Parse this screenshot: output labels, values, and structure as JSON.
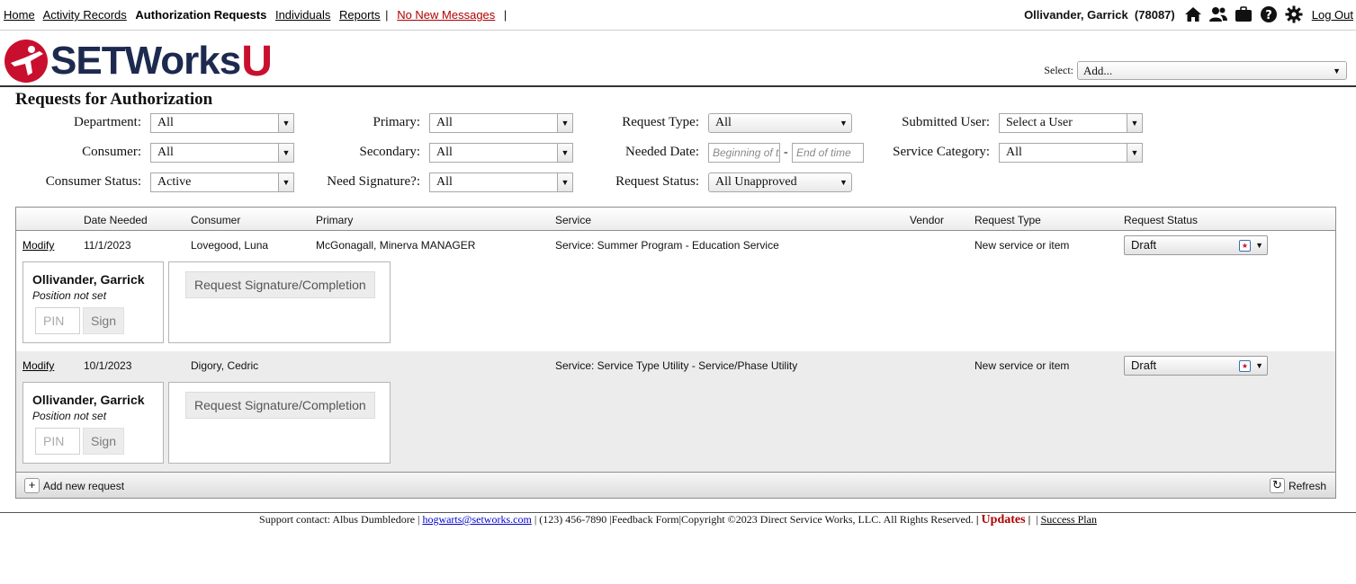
{
  "topnav": {
    "home": "Home",
    "activity_records": "Activity Records",
    "authorization_requests": "Authorization Requests",
    "individuals": "Individuals",
    "reports": "Reports",
    "sep1": "|",
    "messages": "No New Messages",
    "sep2": "|"
  },
  "user": {
    "name": "Ollivander, Garrick",
    "id": "(78087)",
    "logout": "Log Out",
    "icons": [
      "home-icon",
      "users-icon",
      "briefcase-icon",
      "help-icon",
      "gear-icon"
    ]
  },
  "logo": {
    "text": "SETWorks",
    "suffix": "U"
  },
  "select_add": {
    "label": "Select:",
    "value": "Add..."
  },
  "page": {
    "title": "Requests for Authorization"
  },
  "filters": {
    "department": {
      "label": "Department:",
      "value": "All"
    },
    "consumer": {
      "label": "Consumer:",
      "value": "All"
    },
    "consumer_status": {
      "label": "Consumer Status:",
      "value": "Active"
    },
    "primary": {
      "label": "Primary:",
      "value": "All"
    },
    "secondary": {
      "label": "Secondary:",
      "value": "All"
    },
    "need_signature": {
      "label": "Need Signature?:",
      "value": "All"
    },
    "request_type": {
      "label": "Request Type:",
      "value": "All"
    },
    "needed_date": {
      "label": "Needed Date:",
      "from_placeholder": "Beginning of time",
      "to_placeholder": "End of time",
      "dash": "-"
    },
    "request_status": {
      "label": "Request Status:",
      "value": "All Unapproved"
    },
    "submitted_user": {
      "label": "Submitted User:",
      "value": "Select a User"
    },
    "service_category": {
      "label": "Service Category:",
      "value": "All"
    }
  },
  "table": {
    "columns": [
      "Date Needed",
      "Consumer",
      "Primary",
      "Service",
      "Vendor",
      "Request Type",
      "Request Status"
    ],
    "rows": [
      {
        "action": "Modify",
        "date_needed": "11/1/2023",
        "consumer": "Lovegood, Luna",
        "primary": "McGonagall, Minerva MANAGER",
        "service": "Service: Summer Program - Education Service",
        "vendor": "",
        "request_type": "New service or item",
        "status": "Draft",
        "signer": "Ollivander, Garrick",
        "position": "Position not set",
        "pin_placeholder": "PIN",
        "sign_label": "Sign",
        "request_button": "Request Signature/Completion"
      },
      {
        "action": "Modify",
        "date_needed": "10/1/2023",
        "consumer": "Digory, Cedric",
        "primary": "",
        "service": "Service: Service Type Utility - Service/Phase Utility",
        "vendor": "",
        "request_type": "New service or item",
        "status": "Draft",
        "signer": "Ollivander, Garrick",
        "position": "Position not set",
        "pin_placeholder": "PIN",
        "sign_label": "Sign",
        "request_button": "Request Signature/Completion"
      }
    ],
    "footer": {
      "add": "Add new request",
      "refresh": "Refresh"
    }
  },
  "footer": {
    "support": "Support contact: Albus Dumbledore |",
    "email": "hogwarts@setworks.com",
    "phone": "| (123) 456-7890 |",
    "feedback": "Feedback Form",
    "copyright": "|Copyright ©2023 Direct Service Works, LLC. All Rights Reserved.",
    "bar1": "|",
    "updates": "Updates",
    "bar2": "|",
    "bar3": "|",
    "success_plan": "Success Plan"
  },
  "colors": {
    "brand_navy": "#1d2a4f",
    "brand_red": "#c8102e",
    "link_red": "#b00000"
  }
}
